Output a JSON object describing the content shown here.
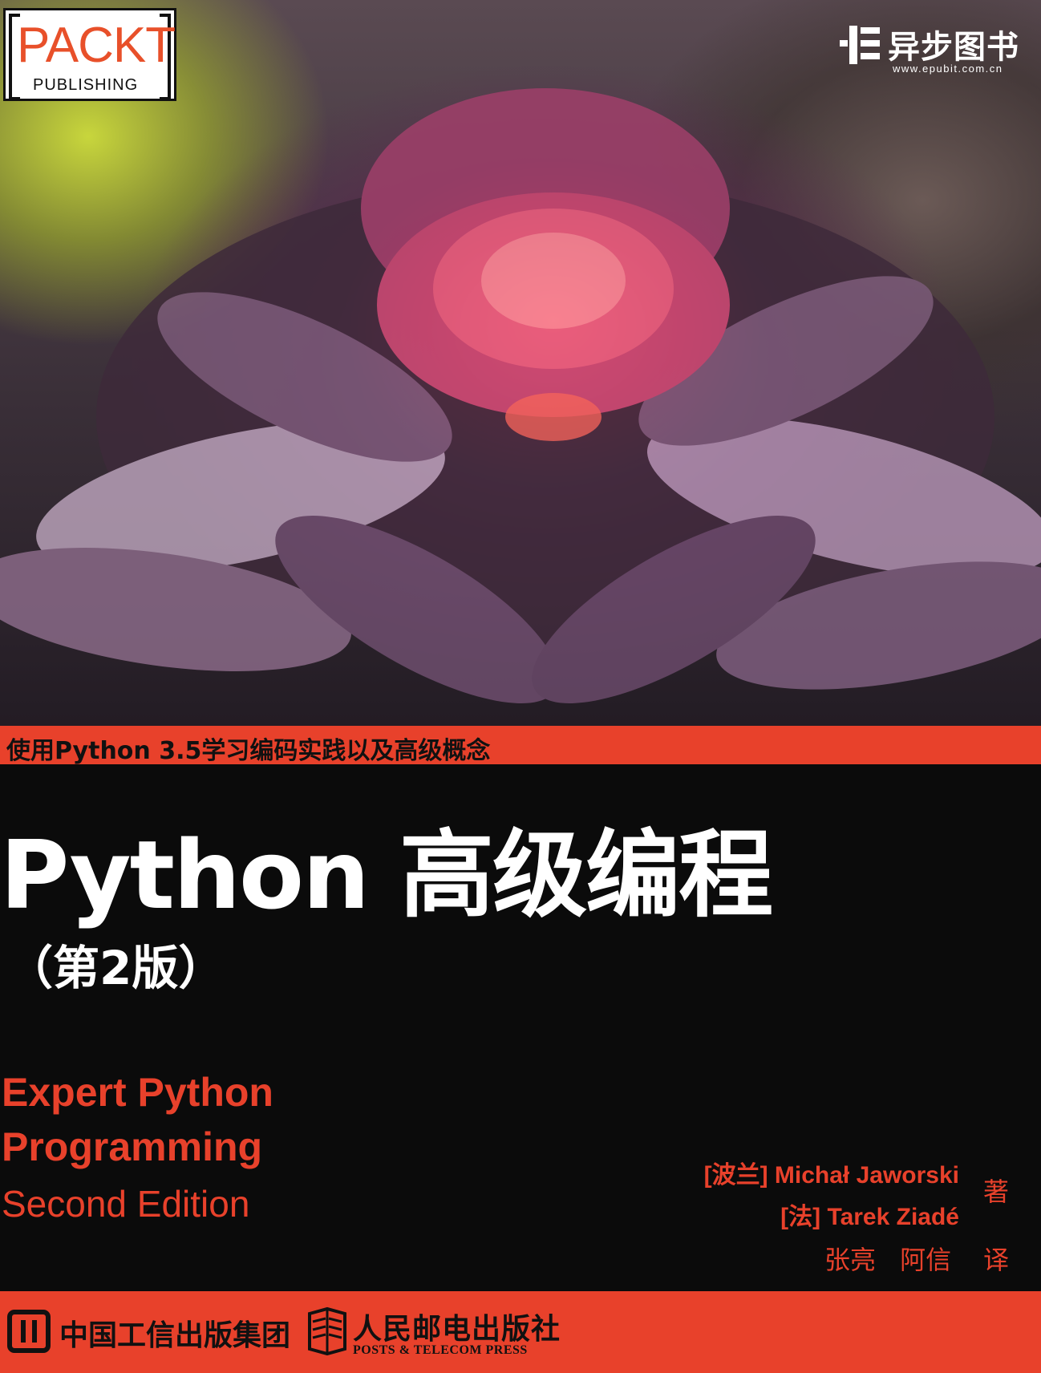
{
  "cover_photo": {
    "subject": "flower-photo"
  },
  "publisher_logo": {
    "word": "PACKT",
    "sub": "PUBLISHING"
  },
  "imprint": {
    "name": "异步图书",
    "url": "www.epubit.com.cn"
  },
  "tagline": "使用Python 3.5学习编码实践以及高级概念",
  "title": "Python 高级编程",
  "edition": "（第2版）",
  "english_title": {
    "line1": "Expert Python",
    "line2": "Programming",
    "edition": "Second Edition"
  },
  "authors": [
    {
      "label": "[波兰] Michał Jaworski"
    },
    {
      "label": "[法] Tarek Ziadé"
    }
  ],
  "author_role": "著",
  "translators": "张亮 阿信",
  "translator_role": "译",
  "footer": {
    "group": "中国工信出版集团",
    "press": "人民邮电出版社",
    "press_en": "POSTS & TELECOM PRESS"
  },
  "colors": {
    "accent": "#e8412b",
    "background": "#0b0b0b",
    "text_light": "#ffffff"
  }
}
